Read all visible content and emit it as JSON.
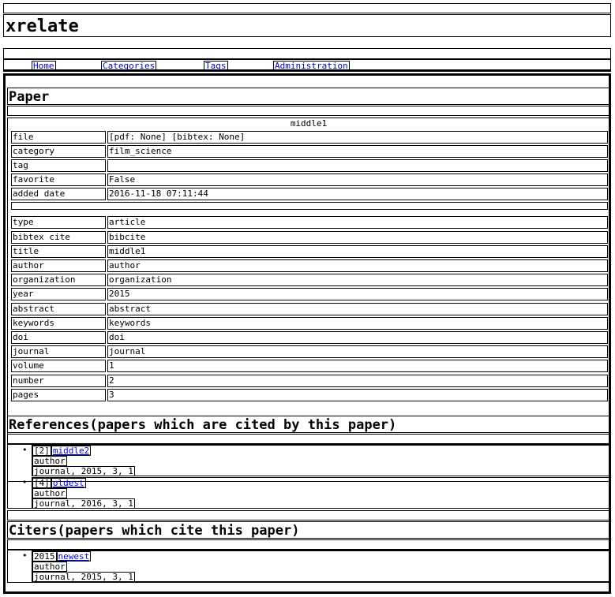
{
  "site": {
    "title": "xrelate"
  },
  "nav": {
    "items": [
      {
        "label": "Home"
      },
      {
        "label": "Categories"
      },
      {
        "label": "Tags"
      },
      {
        "label": "Administration"
      }
    ]
  },
  "paper": {
    "heading": "Paper",
    "name": "middle1",
    "file_links": "[pdf: None] [bibtex: None]",
    "meta_rows": [
      {
        "key": "file",
        "value": "[pdf: None] [bibtex: None]"
      },
      {
        "key": "category",
        "value": "film_science"
      },
      {
        "key": "tag",
        "value": ""
      },
      {
        "key": "favorite",
        "value": "False"
      },
      {
        "key": "added date",
        "value": "2016-11-18 07:11:44"
      }
    ],
    "bib_rows": [
      {
        "key": "type",
        "value": "article"
      },
      {
        "key": "bibtex cite",
        "value": "bibcite"
      },
      {
        "key": "title",
        "value": "middle1"
      },
      {
        "key": "author",
        "value": "author"
      },
      {
        "key": "organization",
        "value": "organization"
      },
      {
        "key": "year",
        "value": "2015"
      },
      {
        "key": "abstract",
        "value": "abstract"
      },
      {
        "key": "keywords",
        "value": "keywords"
      },
      {
        "key": "doi",
        "value": "doi"
      },
      {
        "key": "journal",
        "value": "journal"
      },
      {
        "key": "volume",
        "value": "1"
      },
      {
        "key": "number",
        "value": "2"
      },
      {
        "key": "pages",
        "value": "3"
      }
    ]
  },
  "references": {
    "heading": "References(papers which are cited by this paper)",
    "items": [
      {
        "prefix": "[2]",
        "title": "middle2",
        "author": "author",
        "details": "journal, 2015, 3, 1"
      },
      {
        "prefix": "[4]",
        "title": "oldest",
        "author": "author",
        "details": "journal, 2016, 3, 1"
      }
    ]
  },
  "citers": {
    "heading": "Citers(papers which cite this paper)",
    "items": [
      {
        "prefix": "2015",
        "title": "newest",
        "author": "author",
        "details": "journal, 2015, 3, 1"
      }
    ]
  }
}
